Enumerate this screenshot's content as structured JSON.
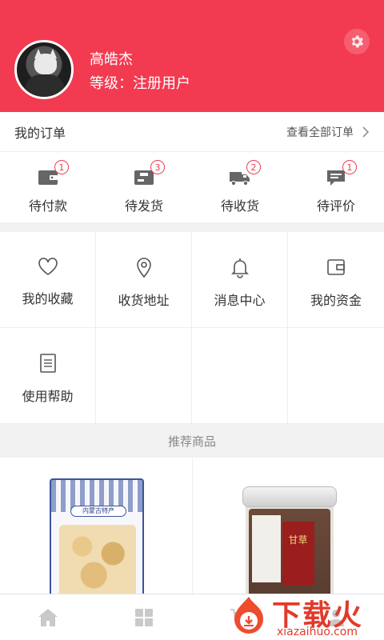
{
  "profile": {
    "username": "高皓杰",
    "level": "等级：注册用户"
  },
  "orders": {
    "title": "我的订单",
    "view_all": "查看全部订单",
    "items": [
      {
        "label": "待付款",
        "count": "1",
        "icon": "wallet-icon"
      },
      {
        "label": "待发货",
        "count": "3",
        "icon": "package-icon"
      },
      {
        "label": "待收货",
        "count": "2",
        "icon": "truck-icon"
      },
      {
        "label": "待评价",
        "count": "1",
        "icon": "comment-icon"
      }
    ]
  },
  "menu": [
    {
      "label": "我的收藏",
      "icon": "heart-icon"
    },
    {
      "label": "收货地址",
      "icon": "location-pin-icon"
    },
    {
      "label": "消息中心",
      "icon": "bell-icon"
    },
    {
      "label": "我的资金",
      "icon": "wallet-icon"
    },
    {
      "label": "使用帮助",
      "icon": "document-icon"
    }
  ],
  "recommend": {
    "title": "推荐商品",
    "products": [
      {
        "label_text": "内蒙古特产"
      },
      {
        "label_text": "甘草"
      }
    ]
  },
  "tabbar": [
    {
      "icon": "home-icon"
    },
    {
      "icon": "category-grid-icon"
    },
    {
      "icon": "cart-icon"
    },
    {
      "icon": "user-icon"
    }
  ],
  "watermark": {
    "text": "下载火",
    "sub": "xiazaihuo.com"
  },
  "colors": {
    "accent": "#f23b51",
    "badge": "#f23b51",
    "icon": "#555555"
  }
}
